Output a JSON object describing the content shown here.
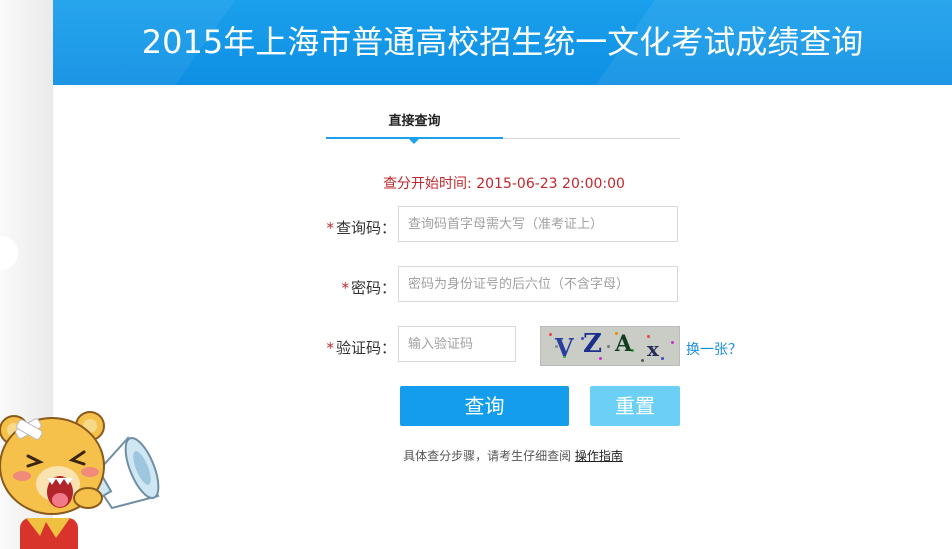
{
  "header": {
    "title": "2015年上海市普通高校招生统一文化考试成绩查询"
  },
  "tabs": [
    {
      "label": "直接查询",
      "active": true
    }
  ],
  "start_time": "查分开始时间: 2015-06-23 20:00:00",
  "form": {
    "required_mark": "*",
    "query_code": {
      "label": "查询码：",
      "placeholder": "查询码首字母需大写（准考证上）",
      "value": ""
    },
    "password": {
      "label": "密码：",
      "placeholder": "密码为身份证号的后六位（不含字母）",
      "value": ""
    },
    "captcha": {
      "label": "验证码：",
      "placeholder": "输入验证码",
      "value": "",
      "image_text": "VZAx",
      "refresh_label": "换一张？"
    }
  },
  "buttons": {
    "query_label": "查询",
    "reset_label": "重置"
  },
  "guide": {
    "text": "具体查分步骤，请考生仔细查阅",
    "link_label": "操作指南"
  },
  "colors": {
    "header_blue": "#1aa0ec",
    "query_button": "#159ded",
    "reset_button": "#6ccff5",
    "alert_red": "#c0282d",
    "link_blue": "#1a8fe0"
  }
}
